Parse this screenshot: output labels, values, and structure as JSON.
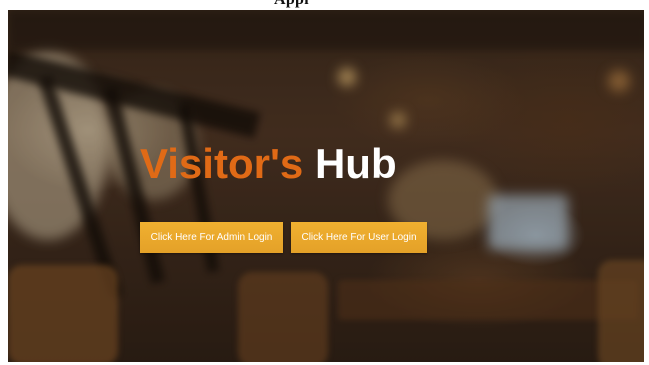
{
  "caption": {
    "text": "Appl"
  },
  "hero": {
    "title_part_a": "Visitor's",
    "title_part_b": "Hub",
    "title_color_a": "#e06a16",
    "title_color_b": "#ffffff"
  },
  "buttons": {
    "admin_label": "Click Here For Admin Login",
    "user_label": "Click Here For User Login",
    "color": "#e9a72c"
  }
}
